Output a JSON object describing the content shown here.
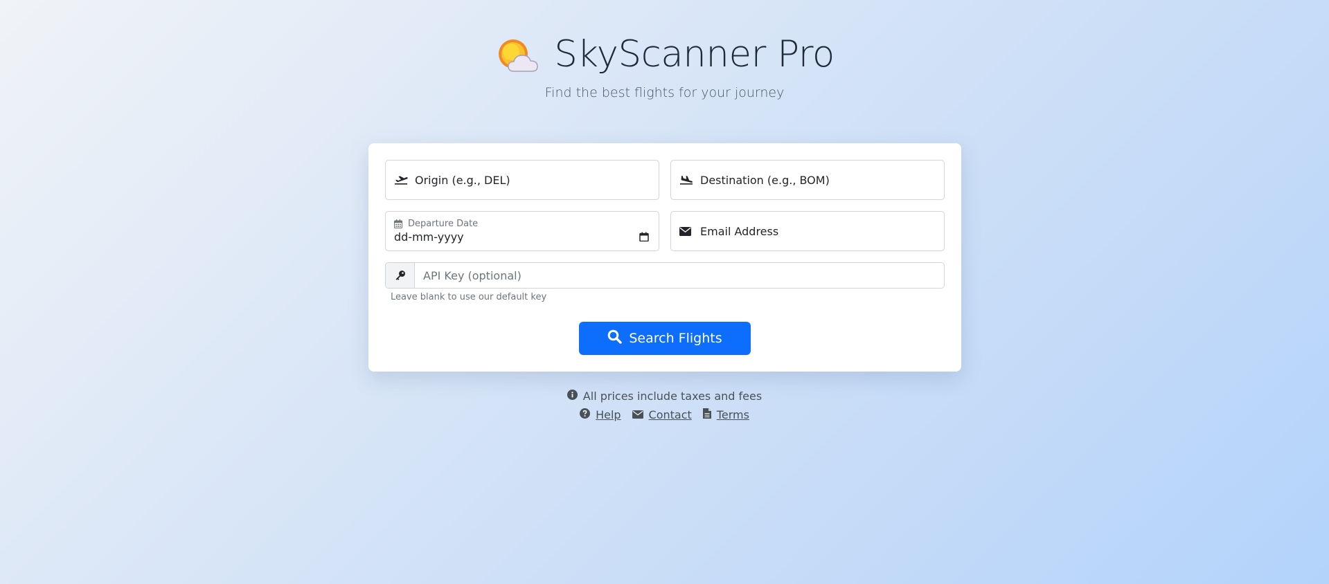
{
  "header": {
    "title": "SkyScanner Pro",
    "subtitle": "Find the best flights for your journey",
    "logo_icon": "sun-behind-cloud-icon"
  },
  "form": {
    "origin": {
      "label": "Origin (e.g., DEL)",
      "icon": "plane-departure-icon"
    },
    "destination": {
      "label": "Destination (e.g., BOM)",
      "icon": "plane-arrival-icon"
    },
    "departure_date": {
      "label": "Departure Date",
      "value": "dd-mm-yyyy",
      "icon": "calendar-icon"
    },
    "email": {
      "label": "Email Address",
      "icon": "envelope-icon"
    },
    "api_key": {
      "placeholder": "API Key (optional)",
      "help": "Leave blank to use our default key",
      "icon": "key-icon"
    },
    "submit_label": "Search Flights"
  },
  "footer": {
    "note": "All prices include taxes and fees",
    "links": [
      {
        "label": "Help",
        "icon": "question-circle-icon"
      },
      {
        "label": "Contact",
        "icon": "envelope-icon"
      },
      {
        "label": "Terms",
        "icon": "file-icon"
      }
    ]
  },
  "colors": {
    "primary": "#0d6efd",
    "sun": "#f5a623",
    "text": "#212529"
  }
}
